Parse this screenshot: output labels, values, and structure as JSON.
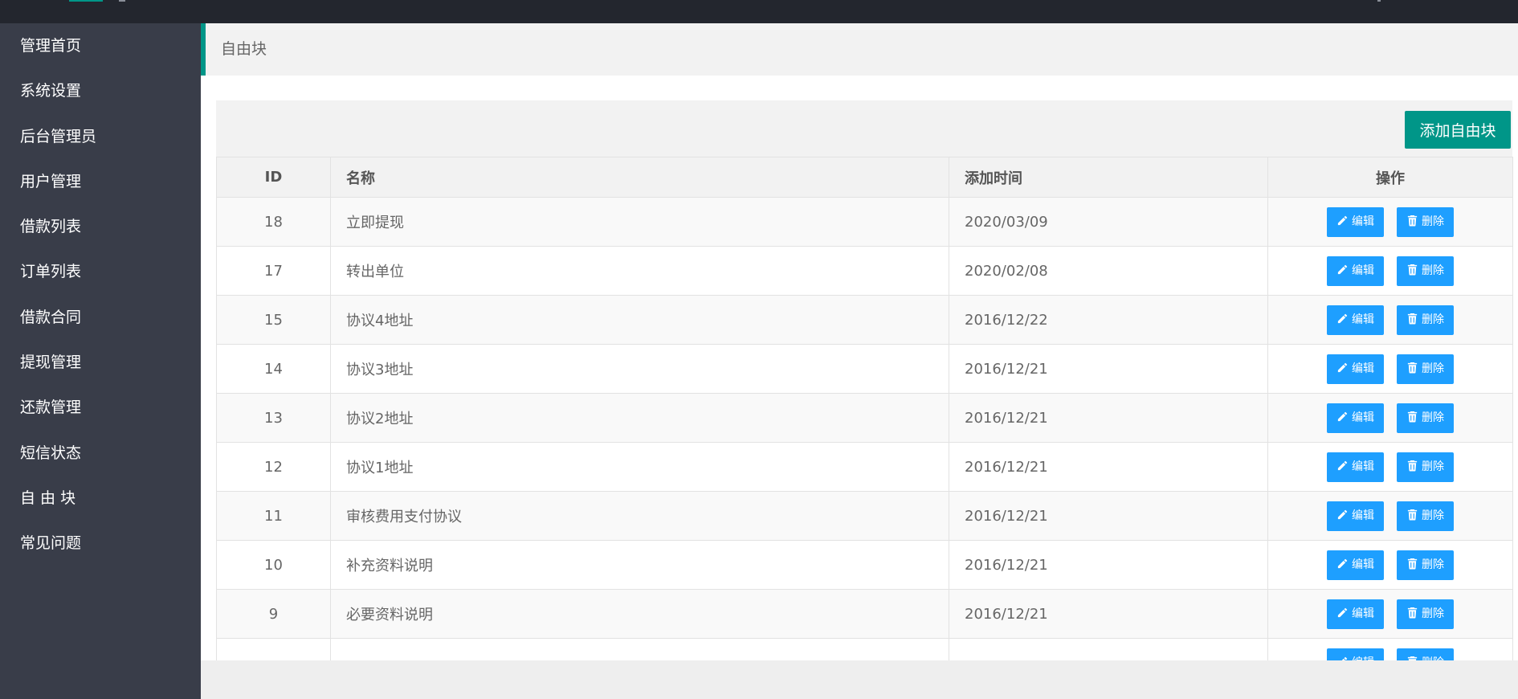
{
  "sidebar": {
    "items": [
      {
        "label": "管理首页"
      },
      {
        "label": "系统设置"
      },
      {
        "label": "后台管理员"
      },
      {
        "label": "用户管理"
      },
      {
        "label": "借款列表"
      },
      {
        "label": "订单列表"
      },
      {
        "label": "借款合同"
      },
      {
        "label": "提现管理"
      },
      {
        "label": "还款管理"
      },
      {
        "label": "短信状态"
      },
      {
        "label": "自 由 块"
      },
      {
        "label": "常见问题"
      }
    ]
  },
  "breadcrumb": {
    "title": "自由块"
  },
  "toolbar": {
    "add_label": "添加自由块"
  },
  "table": {
    "headers": {
      "id": "ID",
      "name": "名称",
      "time": "添加时间",
      "action": "操作"
    },
    "edit_label": "编辑",
    "delete_label": "删除",
    "rows": [
      {
        "id": "18",
        "name": "立即提现",
        "time": "2020/03/09"
      },
      {
        "id": "17",
        "name": "转出单位",
        "time": "2020/02/08"
      },
      {
        "id": "15",
        "name": "协议4地址",
        "time": "2016/12/22"
      },
      {
        "id": "14",
        "name": "协议3地址",
        "time": "2016/12/21"
      },
      {
        "id": "13",
        "name": "协议2地址",
        "time": "2016/12/21"
      },
      {
        "id": "12",
        "name": "协议1地址",
        "time": "2016/12/21"
      },
      {
        "id": "11",
        "name": "审核费用支付协议",
        "time": "2016/12/21"
      },
      {
        "id": "10",
        "name": "补充资料说明",
        "time": "2016/12/21"
      },
      {
        "id": "9",
        "name": "必要资料说明",
        "time": "2016/12/21"
      },
      {
        "id": "",
        "name": "",
        "time": ""
      }
    ]
  },
  "colors": {
    "accent": "#009688",
    "button_blue": "#1e9fff",
    "sidebar_bg": "#393d49",
    "topbar_bg": "#23262e"
  }
}
